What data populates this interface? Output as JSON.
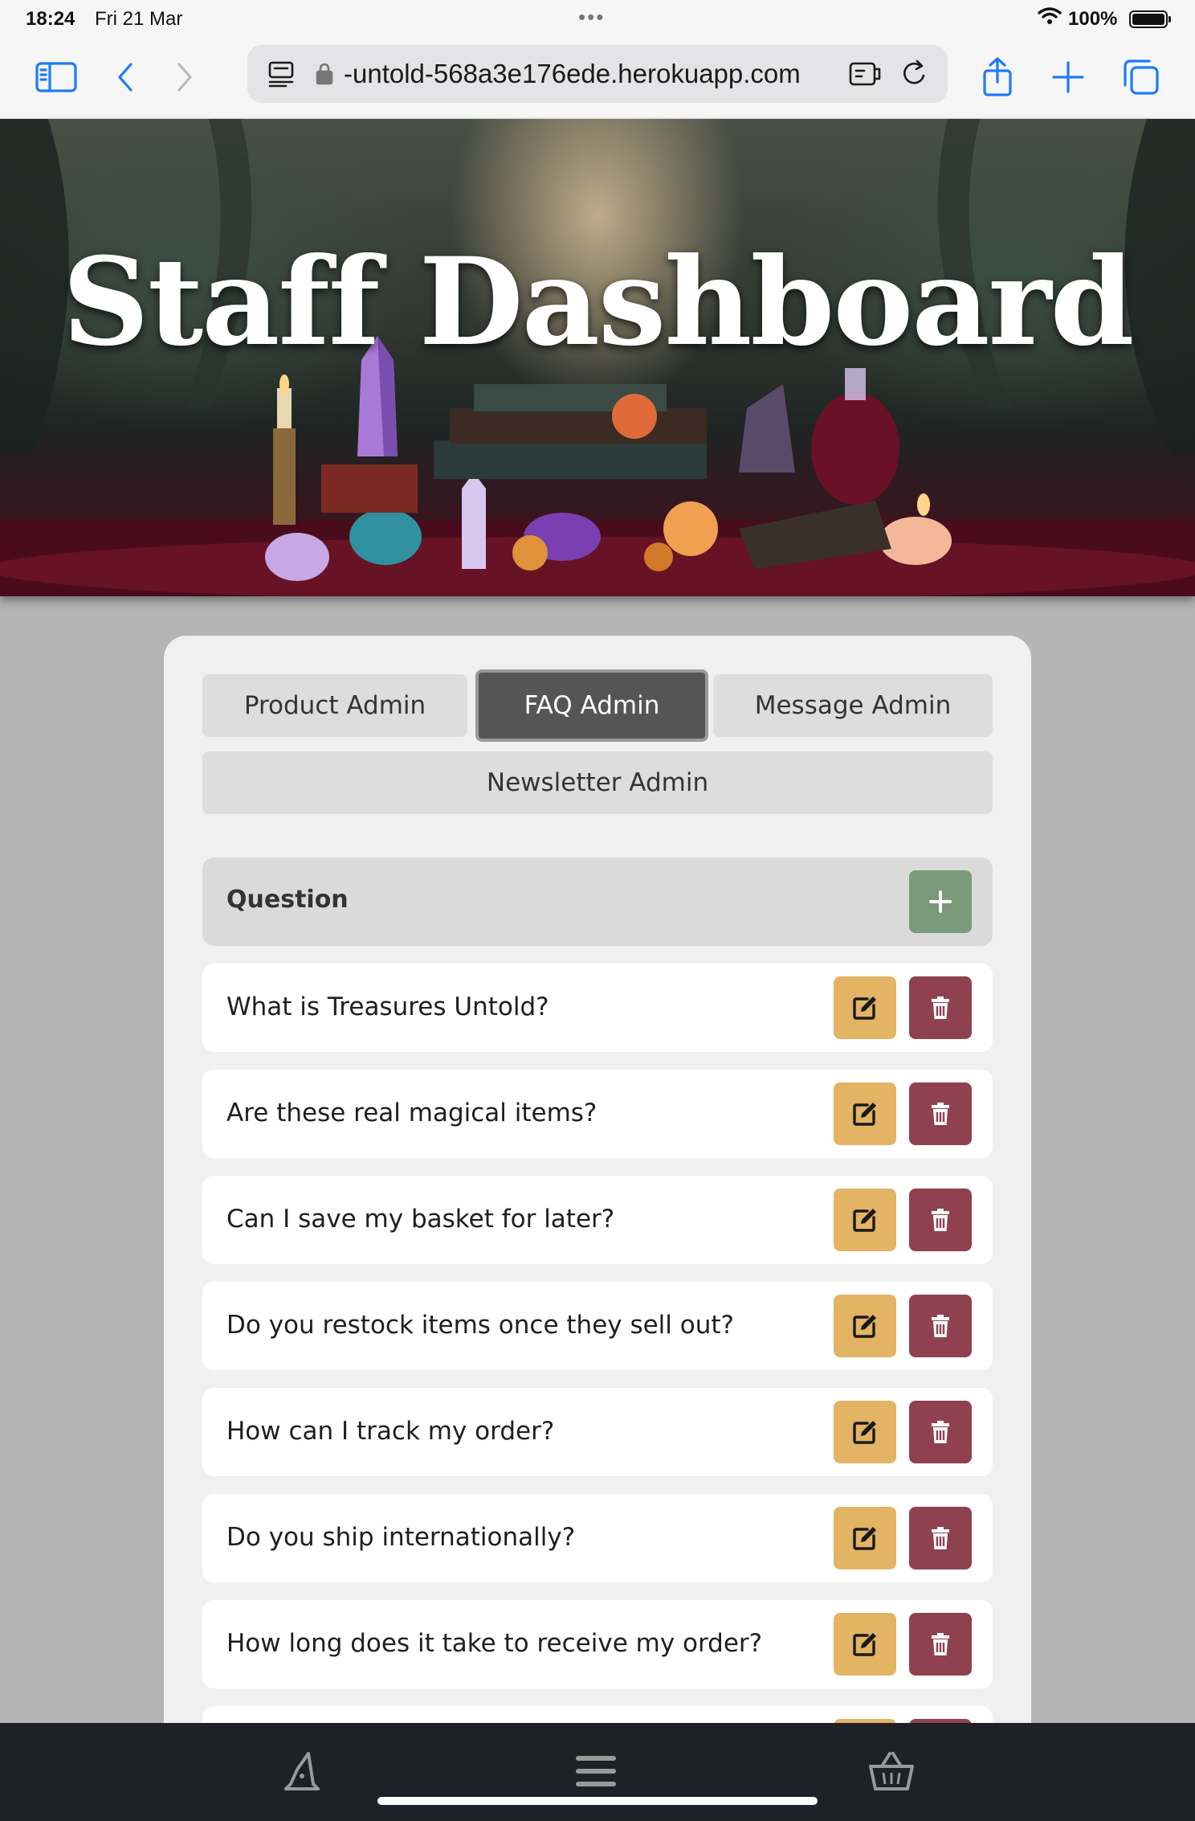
{
  "status_bar": {
    "time": "18:24",
    "date": "Fri 21 Mar",
    "battery": "100%"
  },
  "browser": {
    "url": "-untold-568a3e176ede.herokuapp.com",
    "icons": [
      "sidebar-icon",
      "back-icon",
      "forward-icon",
      "reader-icon",
      "lock-icon",
      "extension-icon",
      "reload-icon",
      "share-icon",
      "new-tab-icon",
      "tabs-icon"
    ]
  },
  "hero": {
    "title": "Staff Dashboard"
  },
  "tabs": [
    {
      "label": "Product Admin",
      "active": false
    },
    {
      "label": "FAQ Admin",
      "active": true
    },
    {
      "label": "Message Admin",
      "active": false
    },
    {
      "label": "Newsletter Admin",
      "active": false
    }
  ],
  "faq_table": {
    "header": "Question",
    "rows": [
      {
        "question": "What is Treasures Untold?"
      },
      {
        "question": "Are these real magical items?"
      },
      {
        "question": "Can I save my basket for later?"
      },
      {
        "question": "Do you restock items once they sell out?"
      },
      {
        "question": "How can I track my order?"
      },
      {
        "question": "Do you ship internationally?"
      },
      {
        "question": "How long does it take to receive my order?"
      }
    ]
  },
  "bottom_nav": {
    "icons": [
      "wizard-hat-icon",
      "menu-icon",
      "basket-icon"
    ]
  },
  "colors": {
    "add": "#7a9a7a",
    "edit": "#e2b463",
    "delete": "#8f4150",
    "active_tab": "#555555",
    "nav_bg": "#1e2125"
  }
}
